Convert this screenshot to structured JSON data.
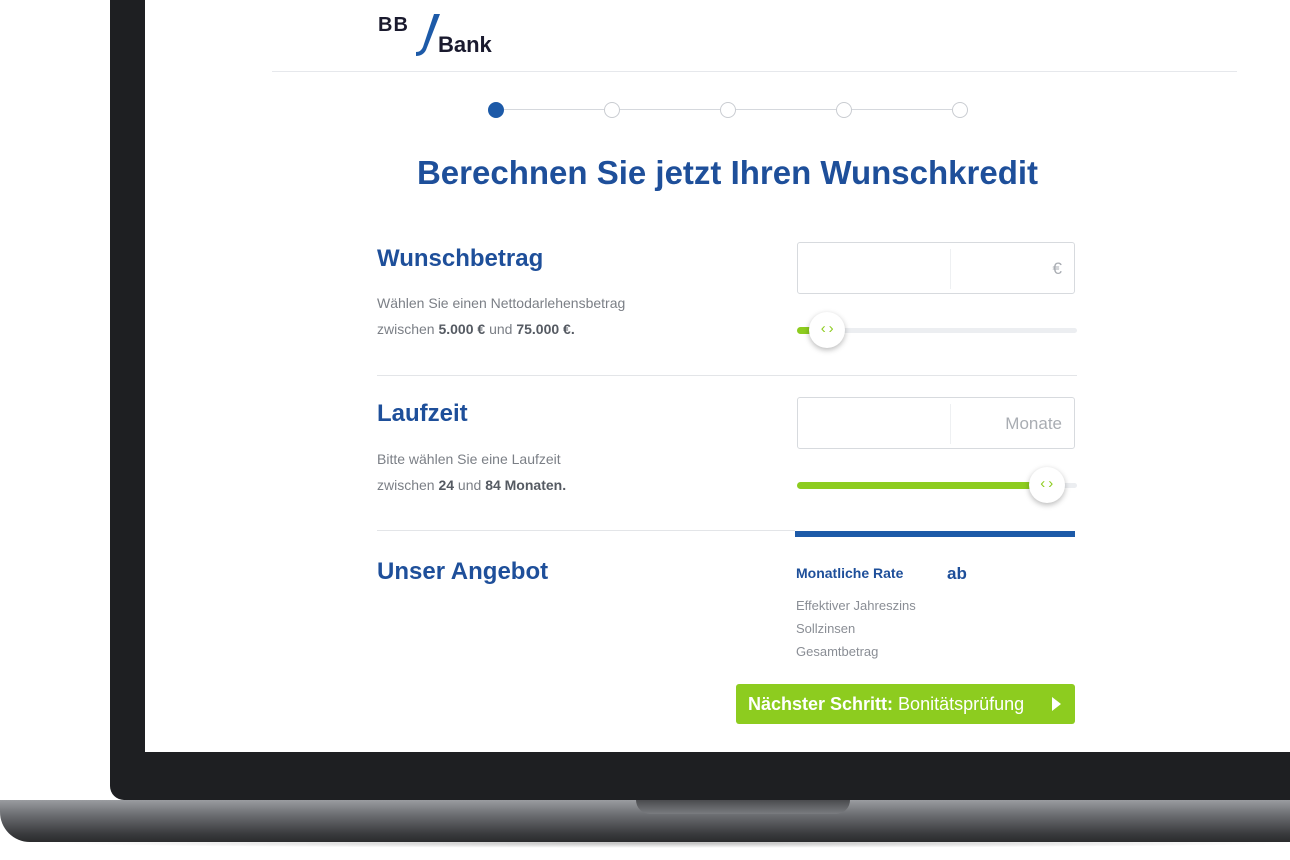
{
  "brand": {
    "prefix": "BB",
    "name": "Bank",
    "accent": "#1d5aa8"
  },
  "steps": {
    "total": 5,
    "current": 1
  },
  "page_title": "Berechnen Sie jetzt Ihren Wunschkredit",
  "wunschbetrag": {
    "title": "Wunschbetrag",
    "desc_line1": "Wählen Sie einen Nettodarlehensbetrag",
    "desc_prefix": "zwischen ",
    "min": "5.000 €",
    "desc_mid": " und ",
    "max": "75.000 €.",
    "input_value": "",
    "unit": "€",
    "slider_level": 0.05
  },
  "laufzeit": {
    "title": "Laufzeit",
    "desc_line1": "Bitte wählen Sie eine Laufzeit",
    "desc_prefix": "zwischen ",
    "min": "24",
    "desc_mid": " und ",
    "max": "84 Monaten.",
    "input_value": "",
    "unit": "Monate",
    "slider_level": 0.95
  },
  "angebot": {
    "title": "Unser Angebot",
    "monthly_label": "Monatliche Rate",
    "monthly_prefix": "ab",
    "rows": [
      "Effektiver Jahreszins",
      "Sollzinsen",
      "Gesamtbetrag"
    ]
  },
  "cta": {
    "bold": "Nächster Schritt:",
    "rest": " Bonitätsprüfung",
    "color": "#8dcc1f"
  }
}
